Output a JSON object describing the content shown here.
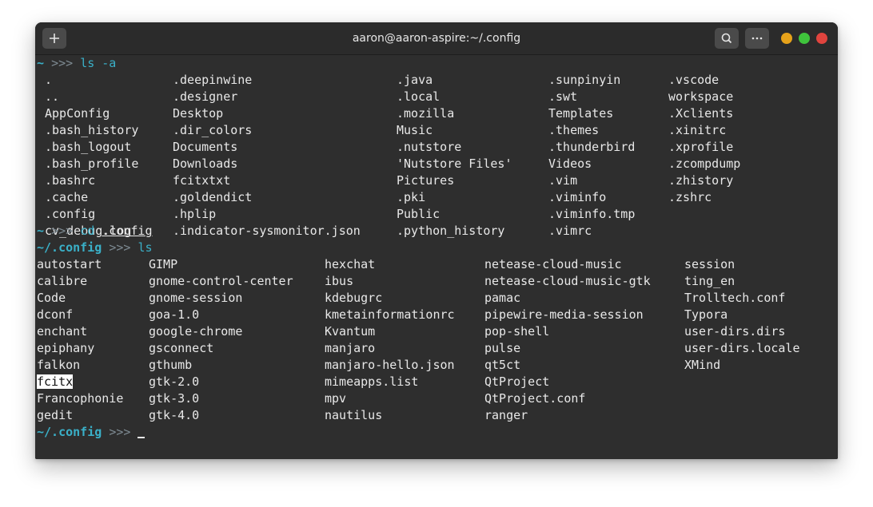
{
  "window": {
    "title": "aaron@aaron-aspire:~/.config"
  },
  "prompt": {
    "home": "~",
    "config_dir": "~/.config",
    "arrow": ">>>"
  },
  "commands": {
    "first": "ls -a",
    "second_cmd": "cd",
    "second_arg": ".config",
    "third": "ls"
  },
  "ls_a": {
    "col1": [
      ".",
      "..",
      "AppConfig",
      ".bash_history",
      ".bash_logout",
      ".bash_profile",
      ".bashrc",
      ".cache",
      ".config",
      "cv_debug.log"
    ],
    "col2": [
      ".deepinwine",
      ".designer",
      "Desktop",
      ".dir_colors",
      "Documents",
      "Downloads",
      "fcitxtxt",
      ".goldendict",
      ".hplip",
      ".indicator-sysmonitor.json"
    ],
    "col3": [
      ".java",
      ".local",
      ".mozilla",
      "Music",
      ".nutstore",
      "'Nutstore Files'",
      "Pictures",
      ".pki",
      "Public",
      ".python_history"
    ],
    "col4": [
      ".sunpinyin",
      ".swt",
      "Templates",
      ".themes",
      ".thunderbird",
      "Videos",
      ".vim",
      ".viminfo",
      ".viminfo.tmp",
      ".vimrc"
    ],
    "col5": [
      ".vscode",
      "workspace",
      ".Xclients",
      ".xinitrc",
      ".xprofile",
      ".zcompdump",
      ".zhistory",
      ".zshrc"
    ]
  },
  "ls_config": {
    "col1": [
      "autostart",
      "calibre",
      "Code",
      "dconf",
      "enchant",
      "epiphany",
      "falkon",
      "fcitx",
      "Francophonie",
      "gedit"
    ],
    "col2": [
      "GIMP",
      "gnome-control-center",
      "gnome-session",
      "goa-1.0",
      "google-chrome",
      "gsconnect",
      "gthumb",
      "gtk-2.0",
      "gtk-3.0",
      "gtk-4.0"
    ],
    "col3": [
      "hexchat",
      "ibus",
      "kdebugrc",
      "kmetainformationrc",
      "Kvantum",
      "manjaro",
      "manjaro-hello.json",
      "mimeapps.list",
      "mpv",
      "nautilus"
    ],
    "col4": [
      "netease-cloud-music",
      "netease-cloud-music-gtk",
      "pamac",
      "pipewire-media-session",
      "pop-shell",
      "pulse",
      "qt5ct",
      "QtProject",
      "QtProject.conf",
      "ranger"
    ],
    "col5": [
      "session",
      "ting_en",
      "Trolltech.conf",
      "Typora",
      "user-dirs.dirs",
      "user-dirs.locale",
      "XMind"
    ]
  },
  "colors": {
    "prompt_accent": "#3ab0c8",
    "close": "#e0443e",
    "maximize": "#3fc33c",
    "minimize": "#e6a21a"
  },
  "icons": {
    "new_tab": "plus-icon",
    "search": "search-icon",
    "menu": "more-icon"
  }
}
